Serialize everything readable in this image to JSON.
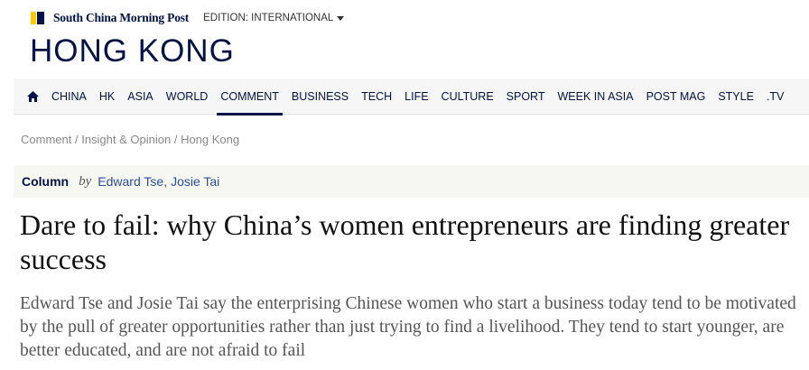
{
  "masthead": {
    "brand": "South China Morning Post",
    "edition_label": "EDITION: INTERNATIONAL"
  },
  "section": {
    "title": "HONG KONG"
  },
  "nav": {
    "items": [
      "CHINA",
      "HK",
      "ASIA",
      "WORLD",
      "COMMENT",
      "BUSINESS",
      "TECH",
      "LIFE",
      "CULTURE",
      "SPORT",
      "WEEK IN ASIA",
      "POST MAG",
      "STYLE",
      ".TV"
    ],
    "active": "COMMENT",
    "home_icon": "home-icon"
  },
  "breadcrumb": {
    "items": [
      "Comment",
      "Insight & Opinion",
      "Hong Kong"
    ],
    "separator": " / "
  },
  "byline": {
    "kind": "Column",
    "by": "by",
    "authors": [
      "Edward Tse",
      "Josie Tai"
    ]
  },
  "article": {
    "headline": "Dare to fail: why China’s women entrepreneurs are finding greater success",
    "summary": "Edward Tse and Josie Tai say the enterprising Chinese women who start a business today tend to be motivated by the pull of greater opportunities rather than just trying to find a livelihood. They tend to start younger, are better educated, and are not afraid to fail"
  },
  "colors": {
    "brand_navy": "#001246",
    "brand_yellow": "#ffca05",
    "link_blue": "#2a4fa0"
  }
}
